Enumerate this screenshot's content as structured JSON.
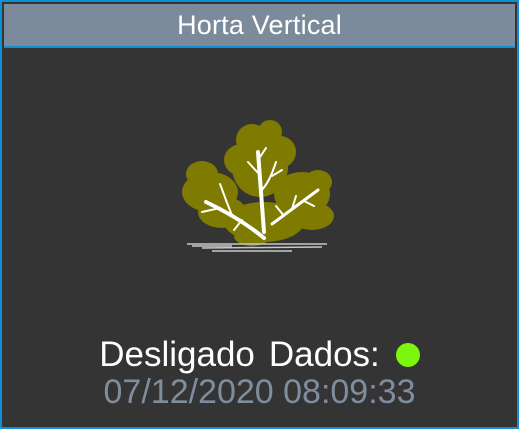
{
  "header": {
    "title": "Horta Vertical"
  },
  "status": {
    "state_label": "Desligado",
    "data_label": "Dados:",
    "indicator_color": "#7cf60e"
  },
  "timestamp": {
    "value": "07/12/2020 08:09:33"
  },
  "colors": {
    "frame": "#0f8fd8",
    "panel": "#343434",
    "title_bar": "#7b8b9b",
    "leaf": "#7f7a00",
    "timestamp_text": "#7f8e9f"
  },
  "icons": {
    "plant": "plant-icon"
  }
}
